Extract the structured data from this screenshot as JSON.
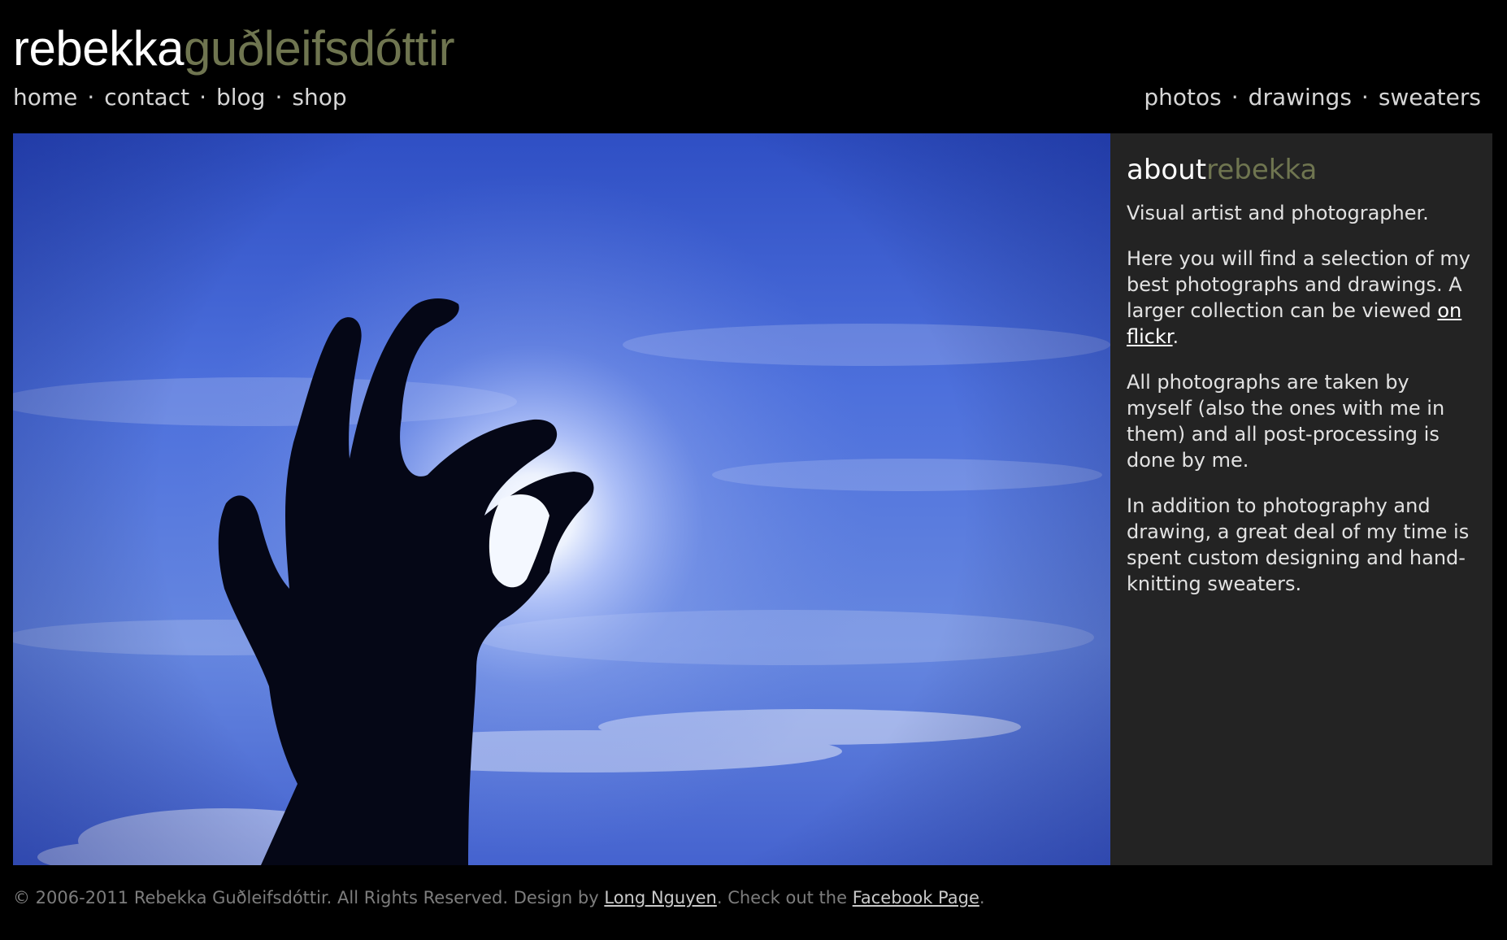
{
  "header": {
    "title_first": "rebekka",
    "title_last": "guðleifsdóttir",
    "title_colors": {
      "first": "#ffffff",
      "last": "#6f7550"
    }
  },
  "nav_left": [
    {
      "label": "home"
    },
    {
      "label": "contact"
    },
    {
      "label": "blog"
    },
    {
      "label": "shop"
    }
  ],
  "nav_right": [
    {
      "label": "photos"
    },
    {
      "label": "drawings"
    },
    {
      "label": "sweaters"
    }
  ],
  "nav_separator": "·",
  "photo": {
    "subject": "silhouette of a hand reaching for the sun against a blue sky",
    "colors": {
      "sky": "#4a6ad6",
      "sun": "#ffffff",
      "hand": "#050716"
    }
  },
  "about": {
    "heading_first": "about",
    "heading_last": "rebekka",
    "p1": "Visual artist and photographer.",
    "p2_text": "Here you will find a selection of my best photographs and drawings. A larger collection can be viewed ",
    "p2_link": "on flickr",
    "p2_end": ".",
    "p3": "All photographs are taken by myself (also the ones with me in them) and all post-processing is done by me.",
    "p4": "In addition to photography and drawing, a great deal of my time is spent custom designing and hand-knitting sweaters.",
    "background": "#232323"
  },
  "footer": {
    "copyright": "© 2006-2011 Rebekka Guðleifsdóttir. All Rights Reserved. Design by ",
    "designer_link": "Long Nguyen",
    "middle": ". Check out the ",
    "facebook_link": "Facebook Page",
    "end": "."
  }
}
